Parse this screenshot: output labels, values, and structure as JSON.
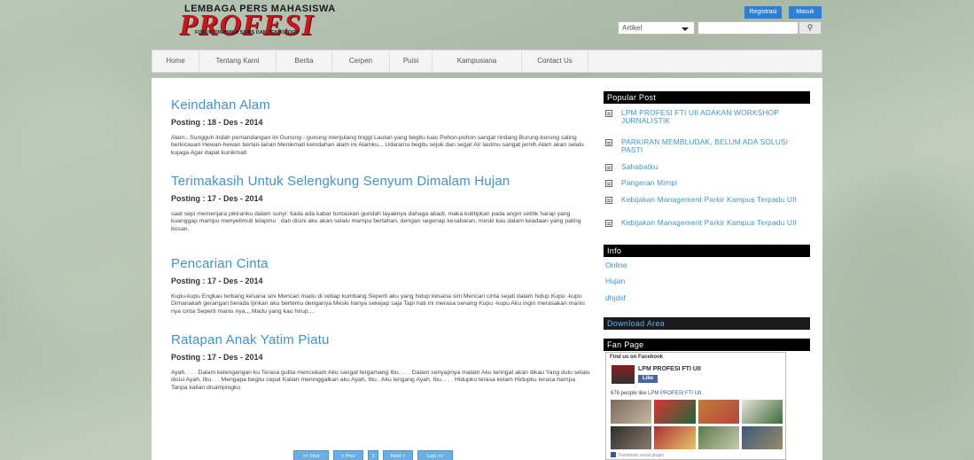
{
  "logo": {
    "top_text": "LEMBAGA PERS MAHASISWA",
    "brand": "PROFESI",
    "sub_text": "FORUM DINAMIKA SAINS DAN TEKNOLOGI"
  },
  "header": {
    "register_label": "Registrasi",
    "login_label": "Masuk"
  },
  "search": {
    "select_value": "Artikel",
    "placeholder": "",
    "icon": "search-icon"
  },
  "nav": {
    "items": [
      "Home",
      "Tentang Kami",
      "Berita",
      "Cerpen",
      "Puisi",
      "Kampusiana",
      "Contact Us"
    ]
  },
  "posts": [
    {
      "title": "Keindahan Alam",
      "date": "Posting : 18 - Des - 2014",
      "body": "Alam.. Sungguh indah pemandangan ini Gunung - gunung menjulang tinggi Lautan yang begitu luas Pohon-pohon sangat rindang Burung-burung saling berkicauan Hewan-hewan berlari-larian Menikmati keindahan alam ini Alamku... Udaramu begitu sejuk dan segar Air lautmu sangat jernih Alam akan selalu kujaga Agar dapat kunikmati"
    },
    {
      "title": "Terimakasih Untuk Selengkung Senyum Dimalam Hujan",
      "date": "Posting : 17 - Des - 2014",
      "body": "saat sepi memenjara pikiranku dalam sunyi: tiada ada kabar tuntaskan gundah layaknya dahaga abadi, maka kutitipkan pada angin setitik harap yang kuanggap mampu menyelimuti lelapmu : dan disini aku akan selalu mampu bertahan, dengan segenap kesabaran, meski kau dalam keadaan yang paling bosan."
    },
    {
      "title": "Pencarian Cinta",
      "date": "Posting : 17 - Des - 2014",
      "body": "Kupu-kupu Engkau terbang kesana sini Mencari madu di setiap kumbang Seperti aku yang hidup kesana sini Mencari cinta sejati dalam hidup Kupu -kupu Dimanakah gerangan berada Ijinkan aku bertemu denganya Meski hanya sekejap saja Tapi hati ini merasa senang Kupu -kupu Aku ingin merasakan manis nya cinta Seperti manis nya,,, Madu yang kau hirup...."
    },
    {
      "title": "Ratapan Anak Yatim Piatu",
      "date": "Posting : 17 - Des - 2014",
      "body": "Ayah. . . . Dalam kelengangan ku Terasa gulita mencekam Aku sangat tergamang Ibu. . . . Dalam senyapnya malam Aku teringat akan dikau Yang dulu selalu disisi Ayah, Ibu. . . Mengapa begitu cepat Kalian meninggalkan aku Ayah, Ibu.. Aku lengang Ayah, Ibu. . . . Hidupku terasa kelam Hidupku terasa hampa Tanpa kalian disampingku"
    }
  ],
  "pager": {
    "first": "<< First",
    "prev": "< Prev",
    "page": "1",
    "next": "Next >",
    "last": "Last >>"
  },
  "sidebar": {
    "popular_title": "Popular Post",
    "popular": [
      "LPM PROFESI FTI UII ADAKAN WORKSHOP JURNALISTIK",
      "PARKIRAN MEMBLUDAK, BELUM ADA SOLUSI PASTI",
      "Sahabatku",
      "Pangeran Mimpi",
      "Kebijakan Management Parkir Kampus Terpadu UII",
      "Kebijakan Management Parkir Kampus Terpadu UII"
    ],
    "info_title": "Info",
    "info": [
      "Online",
      "Hujan",
      "dhjdsf"
    ],
    "download_title": "Download Area",
    "fan_title": "Fan Page",
    "fb": {
      "find_text": "Find us on Facebook",
      "page_name": "LPM PROFESI FTI UII",
      "like_label": "Like",
      "count_text": "676 people like",
      "count_link": "LPM PROFESI FTI UII.",
      "footer": "Facebook social plugin"
    }
  },
  "colors": {
    "accent": "#3d93d6",
    "button": "#2d7fd3",
    "brand_red": "#c8161d"
  }
}
